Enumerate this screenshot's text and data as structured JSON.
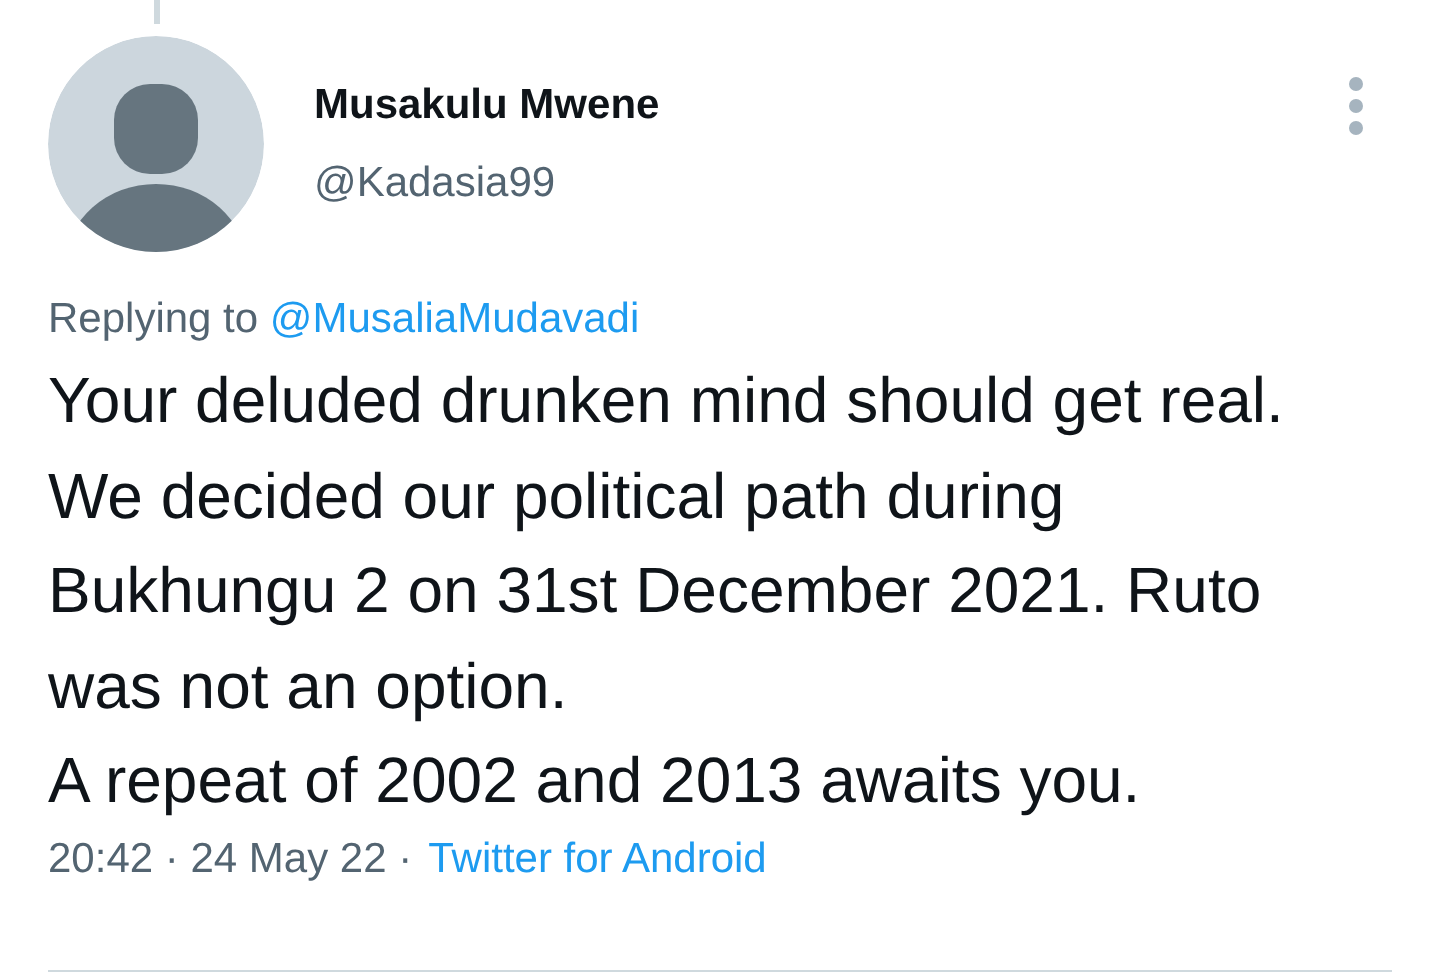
{
  "author": {
    "name": "Musakulu Mwene",
    "handle": "@Kadasia99"
  },
  "reply_to": {
    "prefix": "Replying to",
    "handle": "@MusaliaMudavadi"
  },
  "body": [
    "Your deluded drunken mind should get real. We decided our political path during Bukhungu 2 on 31st December 2021. Ruto was not an option.",
    "A repeat of 2002 and 2013 awaits you."
  ],
  "meta": {
    "timestamp": "20:42 · 24 May 22 ·",
    "source": "Twitter for Android"
  }
}
